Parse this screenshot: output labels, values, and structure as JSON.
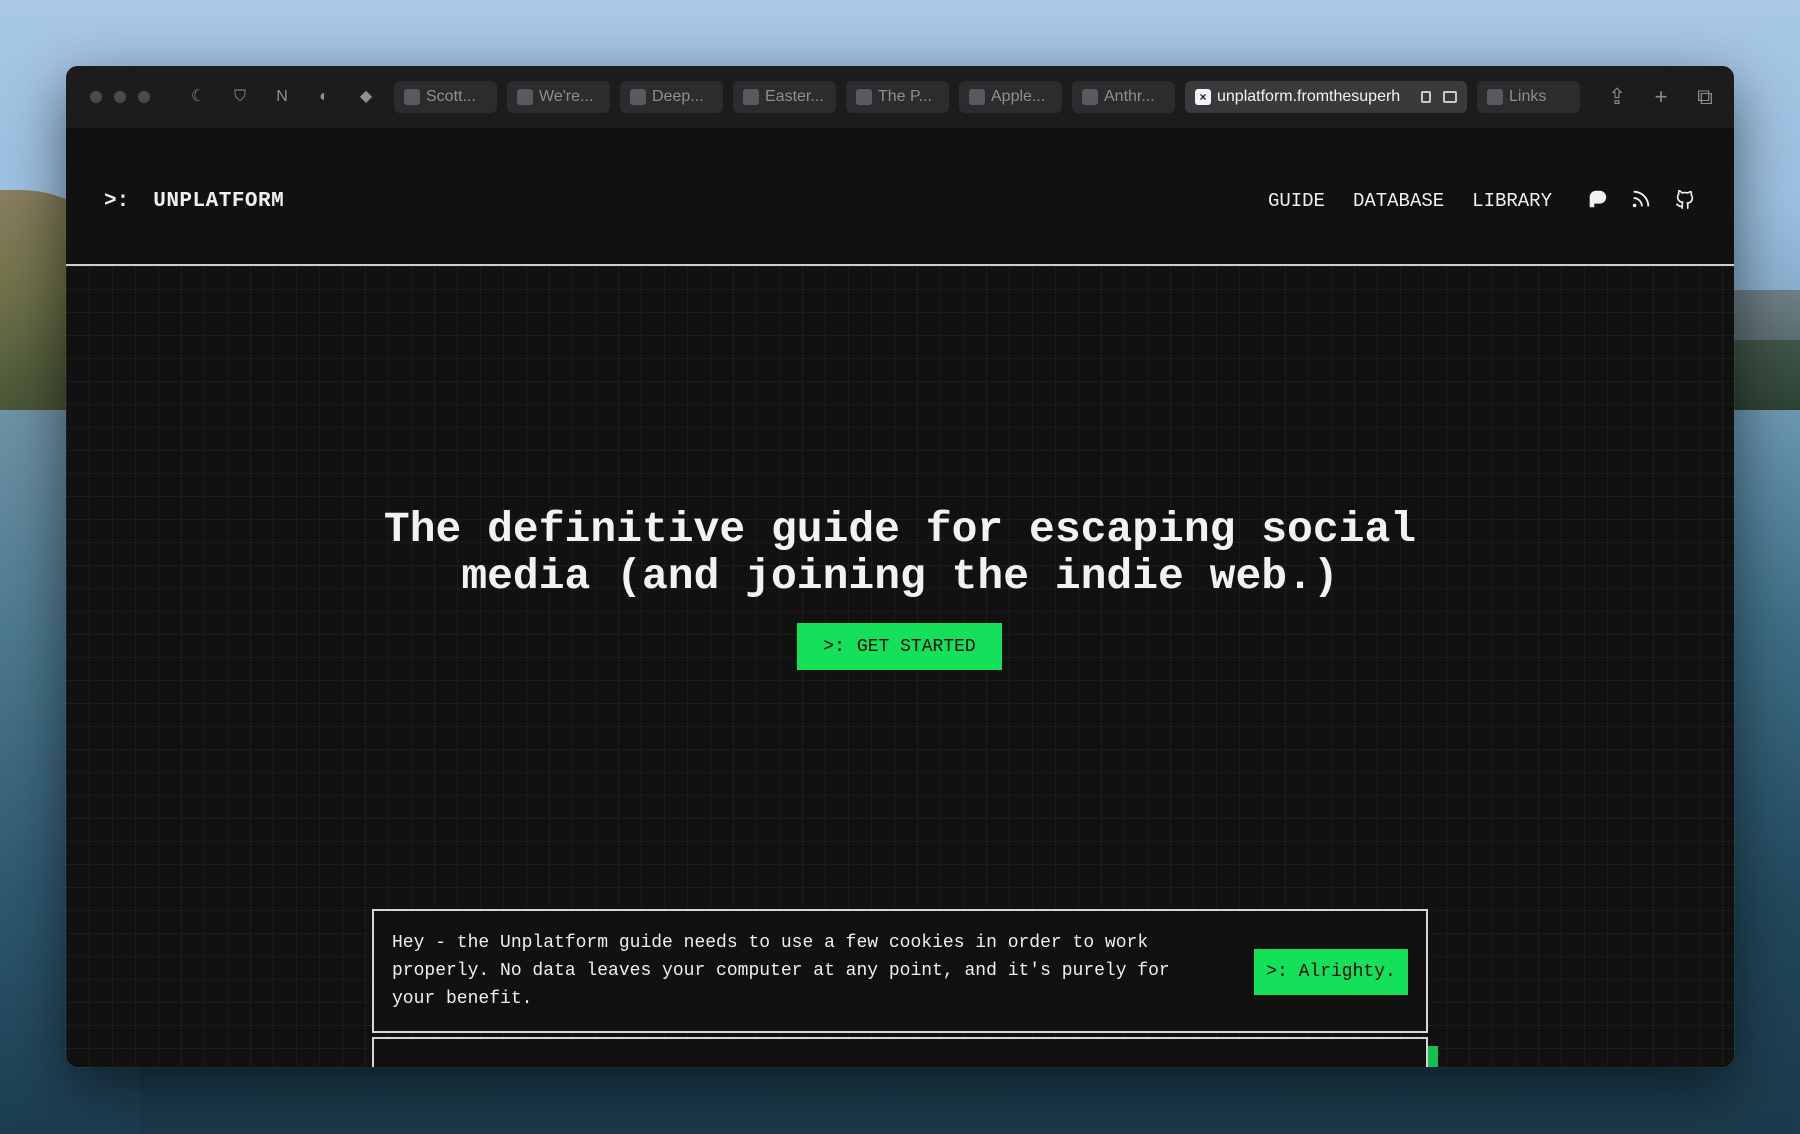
{
  "browser": {
    "tabs": [
      {
        "label": "Scott..."
      },
      {
        "label": "We're..."
      },
      {
        "label": "Deep..."
      },
      {
        "label": "Easter..."
      },
      {
        "label": "The P..."
      },
      {
        "label": "Apple..."
      },
      {
        "label": "Anthr..."
      }
    ],
    "active_tab": {
      "label": "unplatform.fromthesuperh"
    },
    "last_tab": {
      "label": "Links"
    },
    "extensions": [
      "moon-icon",
      "shield-icon",
      "notion-icon",
      "password-icon",
      "diamond-icon"
    ]
  },
  "header": {
    "brand_glyph": ">:",
    "brand_name": "UNPLATFORM",
    "nav": [
      "GUIDE",
      "DATABASE",
      "LIBRARY"
    ],
    "icons": [
      "patreon-icon",
      "rss-icon",
      "github-icon"
    ]
  },
  "hero": {
    "title_line1": "The definitive guide for escaping social",
    "title_line2": "media (and joining the indie web.)",
    "cta_prefix": ">:",
    "cta_label": "GET STARTED"
  },
  "cookie": {
    "line1": "Hey - the Unplatform guide needs to use a few cookies in order to work",
    "line2": "properly. No data leaves your computer at any point, and it's purely for",
    "line3": "your benefit.",
    "button_label": ">: Alrighty."
  },
  "colors": {
    "accent": "#14e05a",
    "background": "#111111",
    "text": "#f2f2f2"
  }
}
